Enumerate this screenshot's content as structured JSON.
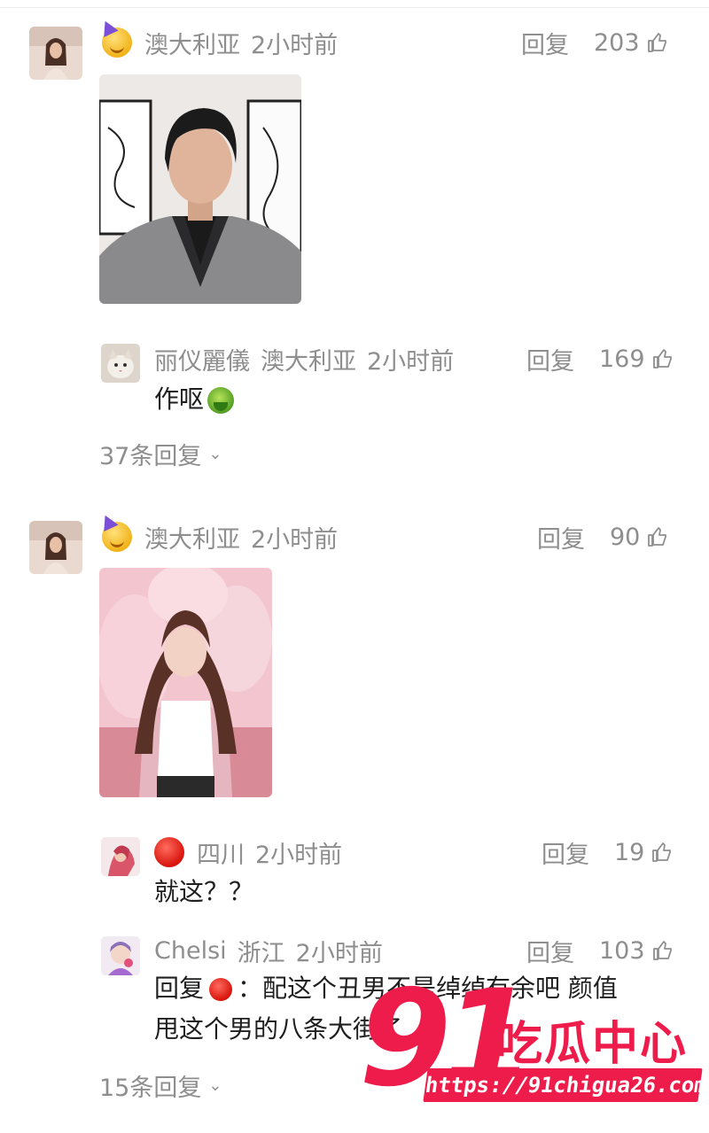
{
  "comments": [
    {
      "location": "澳大利亚",
      "time": "2小时前",
      "reply_label": "回复",
      "likes": "203",
      "reply": {
        "username": "丽仪麗儀",
        "location": "澳大利亚",
        "time": "2小时前",
        "reply_label": "回复",
        "likes": "169",
        "text": "作呕"
      },
      "more_replies": "37条回复"
    },
    {
      "location": "澳大利亚",
      "time": "2小时前",
      "reply_label": "回复",
      "likes": "90",
      "replies": [
        {
          "location": "四川",
          "time": "2小时前",
          "reply_label": "回复",
          "likes": "19",
          "text": "就这？？"
        },
        {
          "username": "Chelsi",
          "location": "浙江",
          "time": "2小时前",
          "reply_label": "回复",
          "likes": "103",
          "text_prefix": "回复",
          "text_line1": "：配这个丑男不是绰绰有余吧 颜值",
          "text_line2": "甩这个男的八条大街了"
        }
      ],
      "more_replies": "15条回复"
    }
  ],
  "watermark": {
    "number": "91",
    "title": "吃瓜中心",
    "url": "https://91chigua26.com"
  },
  "colors": {
    "meta_gray": "#8e8e8e",
    "text": "#1f1f1f",
    "watermark_red": "#ee1c4a"
  }
}
